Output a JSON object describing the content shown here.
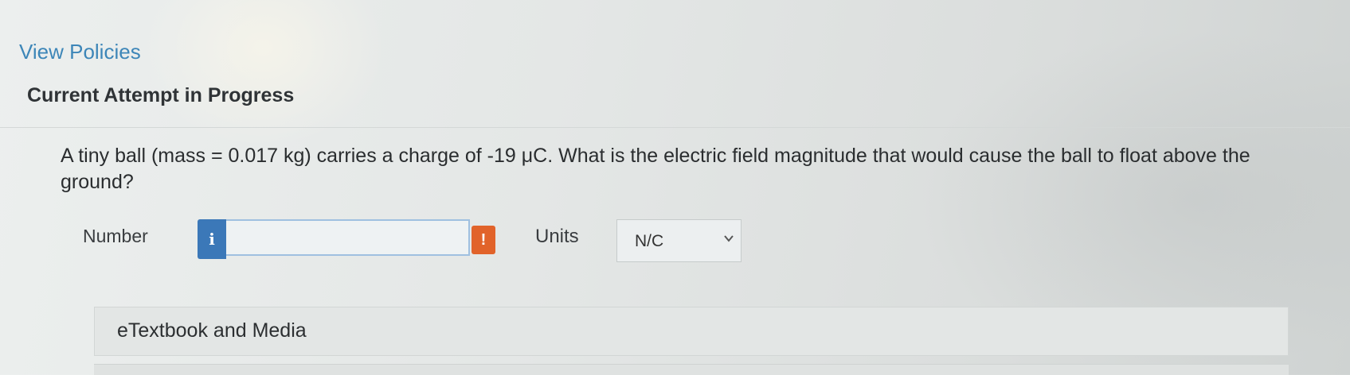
{
  "links": {
    "view_policies": "View Policies"
  },
  "attempt": {
    "heading": "Current Attempt in Progress"
  },
  "question": {
    "text": "A tiny ball (mass = 0.017 kg) carries a charge of -19 μC. What is the electric field magnitude that would cause the ball to float above the ground?"
  },
  "answer": {
    "number_label": "Number",
    "info_icon_glyph": "i",
    "number_value": "",
    "alert_icon_glyph": "!",
    "units_label": "Units",
    "units_selected": "N/C"
  },
  "resources": {
    "etextbook_label": "eTextbook and Media"
  },
  "colors": {
    "link": "#3d86b8",
    "info_button": "#3b78b8",
    "alert": "#e1632a"
  }
}
